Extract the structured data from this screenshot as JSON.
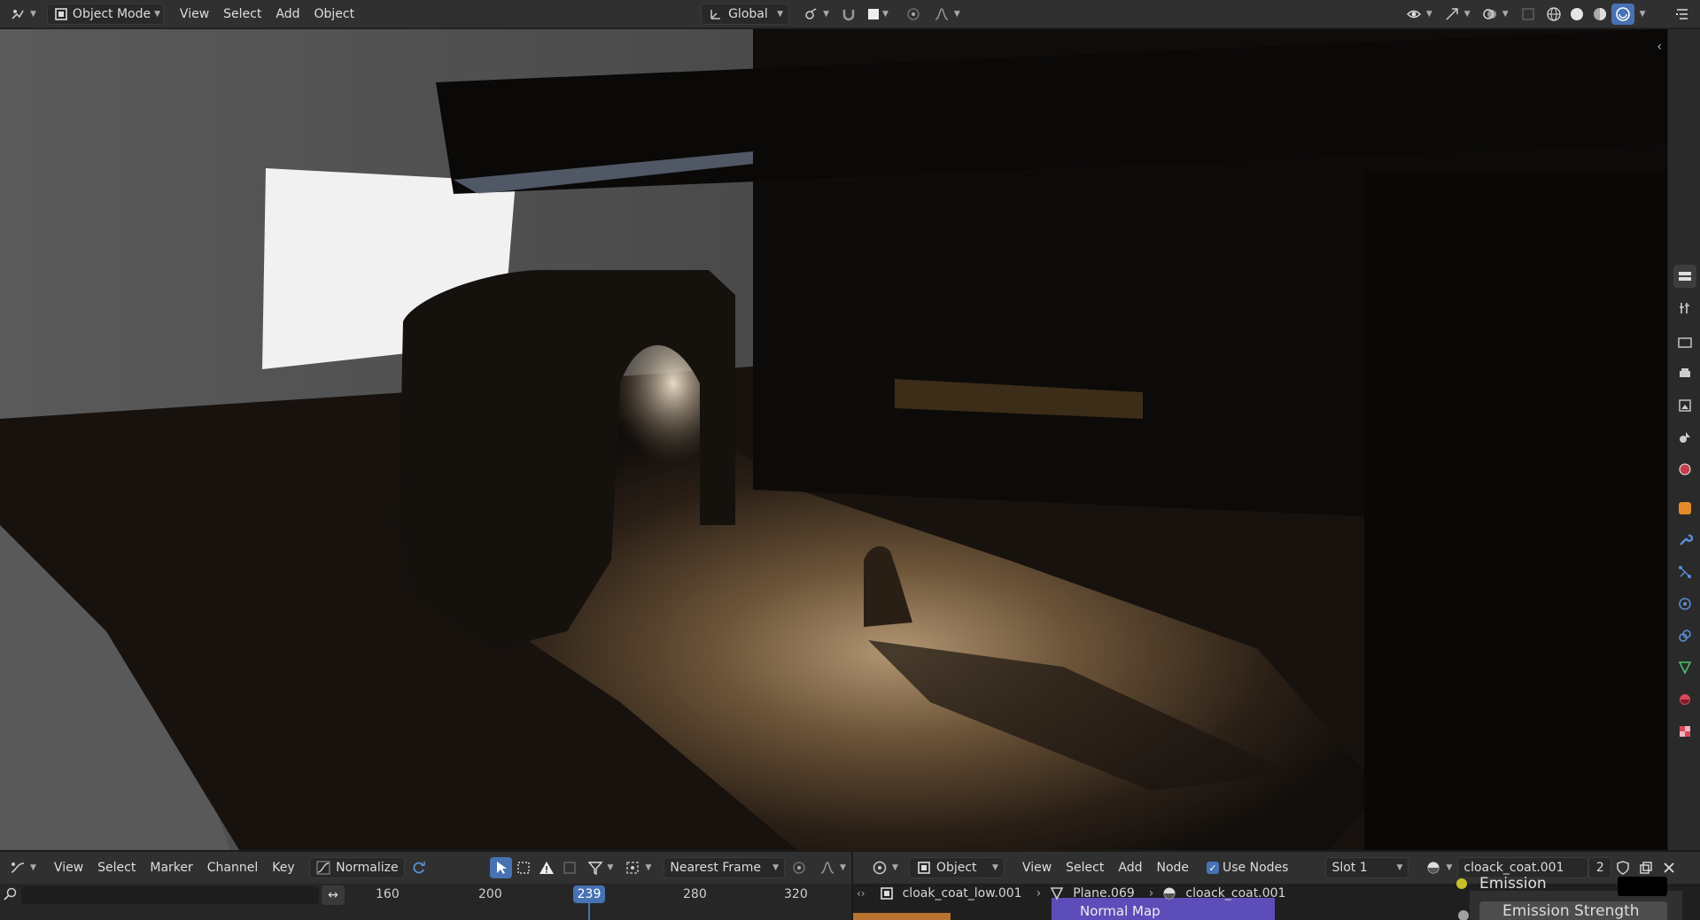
{
  "top_header": {
    "mode_label": "Object Mode",
    "menus": [
      "View",
      "Select",
      "Add",
      "Object"
    ],
    "transform_orientation": "Global"
  },
  "timeline": {
    "menus": [
      "View",
      "Select",
      "Marker",
      "Channel",
      "Key"
    ],
    "normalize_label": "Normalize",
    "snap_mode": "Nearest Frame",
    "ticks": [
      "160",
      "200",
      "239",
      "280",
      "320"
    ],
    "current_frame": "239"
  },
  "node_editor": {
    "object_label": "Object",
    "menus": [
      "View",
      "Select",
      "Add",
      "Node"
    ],
    "use_nodes_label": "Use Nodes",
    "slot_label": "Slot 1",
    "material_name": "cloack_coat.001",
    "user_count": "2",
    "breadcrumb": [
      "cloak_coat_low.001",
      "Plane.069",
      "cloack_coat.001"
    ],
    "node_title": "Normal Map",
    "emission_label": "Emission",
    "emission_strength_label": "Emission Strength"
  },
  "colors": {
    "accent": "#4772b3",
    "header_bg": "#303030",
    "emission_yellow": "#c7c22a"
  }
}
